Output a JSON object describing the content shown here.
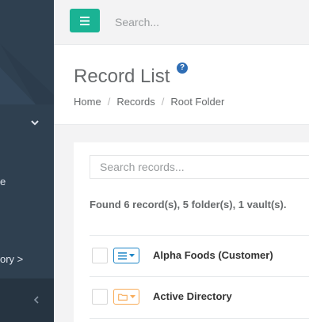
{
  "sidebar": {
    "fragment_1": "e",
    "fragment_2": "ory >"
  },
  "topbar": {
    "search_placeholder": "Search..."
  },
  "heading": {
    "title": "Record List",
    "help": "?",
    "breadcrumb": [
      "Home",
      "Records",
      "Root Folder"
    ],
    "separator": "/"
  },
  "content": {
    "search_placeholder": "Search records...",
    "found_text": "Found 6 record(s), 5 folder(s), 1 vault(s).",
    "rows": [
      {
        "label": "Alpha Foods (Customer)",
        "type": "record"
      },
      {
        "label": "Active Directory",
        "type": "folder"
      }
    ]
  },
  "colors": {
    "sidebar": "#2f4050",
    "accent_green": "#1ab394",
    "record_blue": "#1c84c6",
    "folder_orange": "#f8ac59"
  }
}
